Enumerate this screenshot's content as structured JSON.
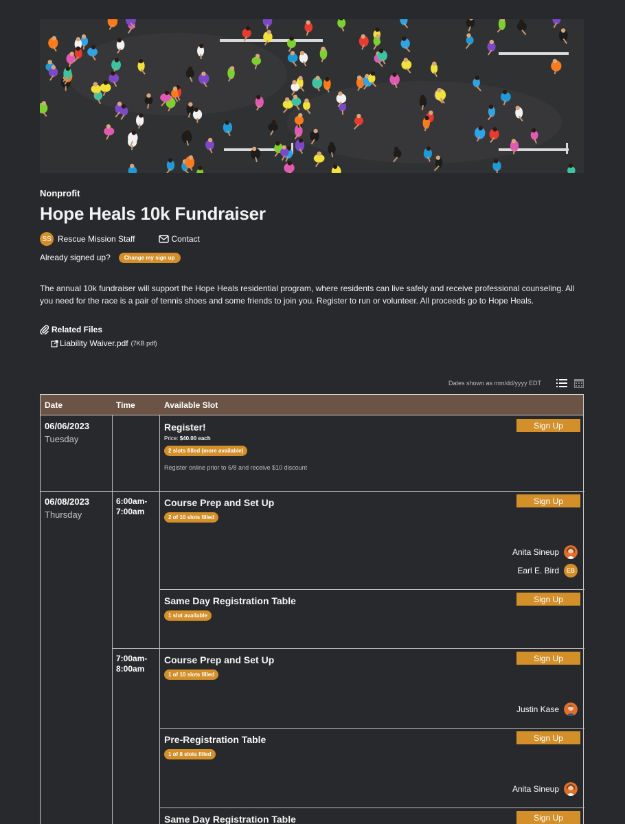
{
  "event": {
    "category": "Nonprofit",
    "title": "Hope Heals 10k Fundraiser",
    "organizer_initials": "SS",
    "organizer_name": "Rescue Mission Staff",
    "contact_label": "Contact",
    "signed_up_prompt": "Already signed up?",
    "change_signup_label": "Change my sign up",
    "description": "The annual 10k fundraiser will support the Hope Heals residential program, where residents can live safely and receive professional counseling. All you need for the race is a pair of tennis shoes and some friends to join you. Register to run or volunteer. All proceeds go to Hope Heals."
  },
  "files": {
    "heading": "Related Files",
    "items": [
      {
        "name": "Liability Waiver.pdf",
        "size": "(7KB pdf)"
      }
    ]
  },
  "schedule": {
    "dates_note": "Dates shown as mm/dd/yyyy EDT",
    "headers": {
      "date": "Date",
      "time": "Time",
      "slot": "Available Slot"
    },
    "signup_label": "Sign Up",
    "dates": [
      {
        "date": "06/06/2023",
        "day": "Tuesday"
      },
      {
        "date": "06/08/2023",
        "day": "Thursday"
      }
    ],
    "times": [
      "6:00am-\n7:00am",
      "7:00am-\n8:00am"
    ],
    "slots": [
      {
        "title": "Register!",
        "price_label": "Price:",
        "price": "$40.00 each",
        "badge": "2 slots filled (more available)",
        "note": "Register online prior to 6/8 and receive $10 discount"
      },
      {
        "title": "Course Prep and Set Up",
        "badge": "2 of 10 slots filled",
        "volunteers": [
          {
            "name": "Anita Sineup",
            "avatar": "photo-female"
          },
          {
            "name": "Earl E. Bird",
            "initials": "EB"
          }
        ]
      },
      {
        "title": "Same Day Registration Table",
        "badge": "1 slot available"
      },
      {
        "title": "Course Prep and Set Up",
        "badge": "1 of 10 slots filled",
        "volunteers": [
          {
            "name": "Justin Kase",
            "avatar": "photo-male"
          }
        ]
      },
      {
        "title": "Pre-Registration Table",
        "badge": "1 of 8 slots filled",
        "volunteers": [
          {
            "name": "Anita Sineup",
            "avatar": "photo-female"
          }
        ]
      },
      {
        "title": "Same Day Registration Table"
      }
    ]
  },
  "colors": {
    "background": "#27292c",
    "accent": "#d38f2a",
    "table_header": "#6b5446"
  },
  "icons": [
    "envelope-icon",
    "paperclip-icon",
    "external-link-icon",
    "list-view-icon",
    "calendar-view-icon"
  ]
}
